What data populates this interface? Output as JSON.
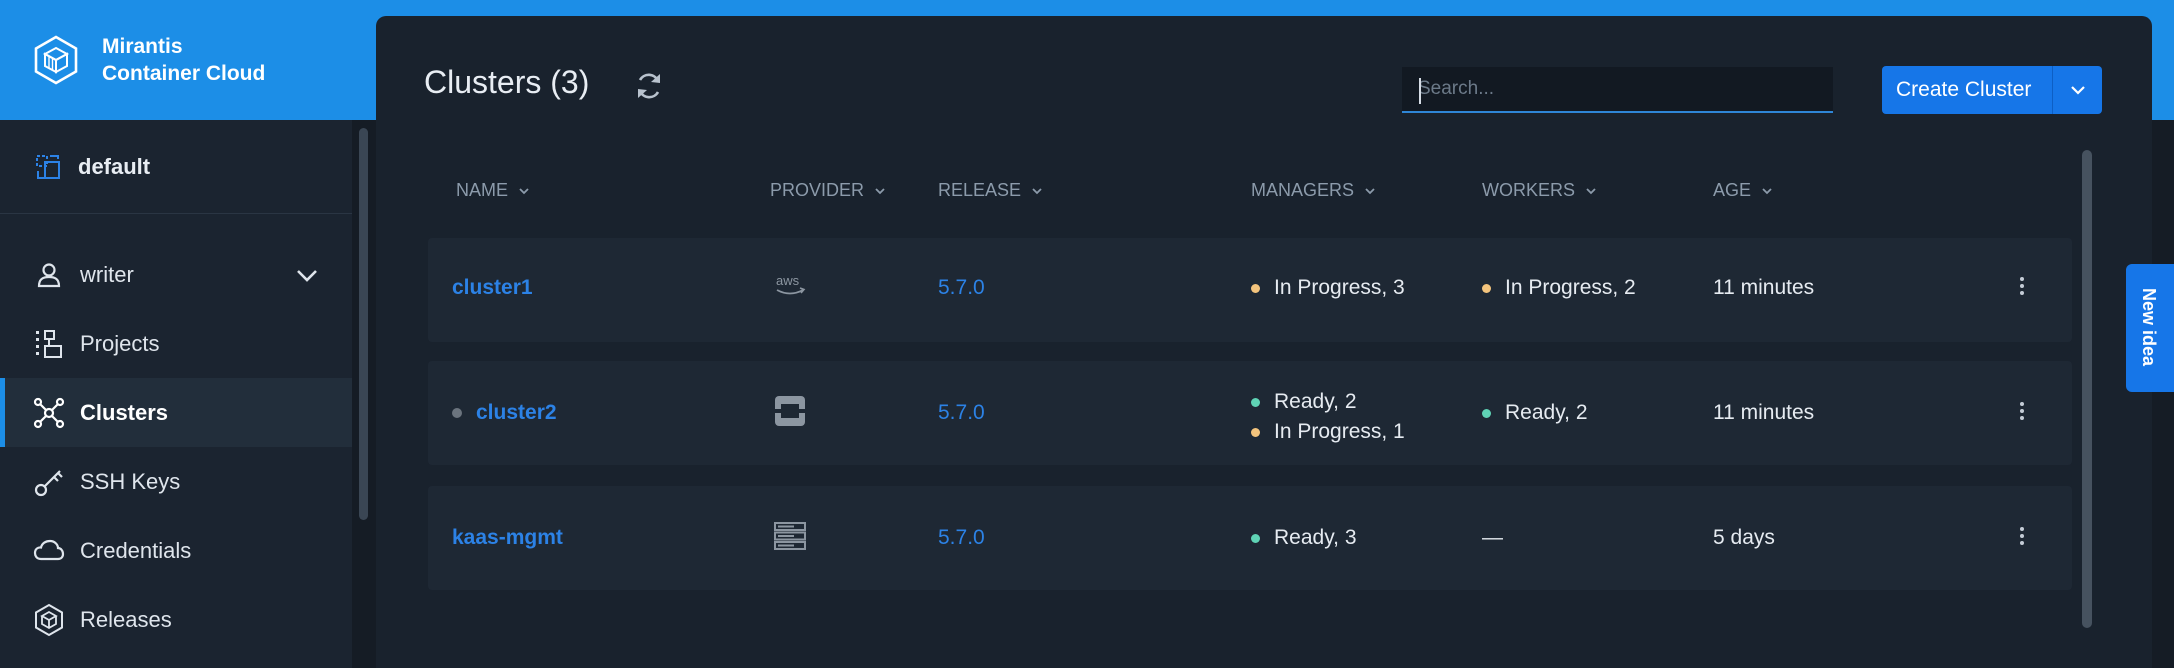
{
  "brand": {
    "line1": "Mirantis",
    "line2": "Container Cloud",
    "logo_icon": "cube-stack-logo"
  },
  "sidebar": {
    "namespace": {
      "label": "default",
      "icon": "namespace-switch-icon"
    },
    "items": [
      {
        "label": "writer",
        "icon": "user-icon",
        "expandable": true
      },
      {
        "label": "Projects",
        "icon": "projects-icon"
      },
      {
        "label": "Clusters",
        "icon": "clusters-icon",
        "active": true
      },
      {
        "label": "SSH Keys",
        "icon": "key-icon"
      },
      {
        "label": "Credentials",
        "icon": "cloud-icon"
      },
      {
        "label": "Releases",
        "icon": "package-icon"
      }
    ]
  },
  "header": {
    "title": "Clusters (3)",
    "search_placeholder": "Search...",
    "create_label": "Create Cluster"
  },
  "table": {
    "columns": [
      "NAME",
      "PROVIDER",
      "RELEASE",
      "MANAGERS",
      "WORKERS",
      "AGE"
    ],
    "rows": [
      {
        "name": "cluster1",
        "provider_icon": "aws-icon",
        "release": "5.7.0",
        "managers": [
          {
            "state": "In Progress, 3",
            "color": "#f3c47d"
          }
        ],
        "workers": [
          {
            "state": "In Progress, 2",
            "color": "#f3c47d"
          }
        ],
        "age": "11 minutes"
      },
      {
        "name": "cluster2",
        "name_dot_color": "#6b747e",
        "provider_icon": "openstack-icon",
        "release": "5.7.0",
        "managers": [
          {
            "state": "Ready, 2",
            "color": "#5fd3b5"
          },
          {
            "state": "In Progress, 1",
            "color": "#f3c47d"
          }
        ],
        "workers": [
          {
            "state": "Ready, 2",
            "color": "#5fd3b5"
          }
        ],
        "age": "11 minutes"
      },
      {
        "name": "kaas-mgmt",
        "provider_icon": "baremetal-server-icon",
        "release": "5.7.0",
        "managers": [
          {
            "state": "Ready, 3",
            "color": "#5fd3b5"
          }
        ],
        "workers": [
          {
            "state": "—",
            "color": ""
          }
        ],
        "age": "5 days"
      }
    ]
  },
  "feedback": {
    "label": "New idea"
  },
  "colors": {
    "accent": "#1c8ee7",
    "button": "#1676e8",
    "link": "#2c82e6",
    "ready": "#5fd3b5",
    "in_progress": "#f3c47d"
  }
}
